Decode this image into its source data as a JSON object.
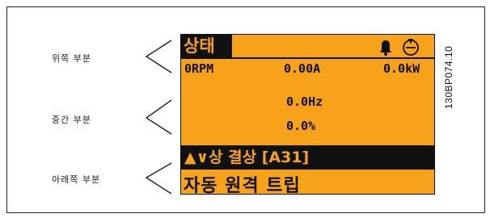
{
  "labels": {
    "top": "위쪽 부분",
    "middle": "중간 부분",
    "bottom": "아래쪽 부분"
  },
  "display": {
    "status_title": "상태",
    "readouts": {
      "speed": "0RPM",
      "current": "0.00A",
      "power": "0.0kW"
    },
    "frequency": "0.0Hz",
    "percent": "0.0%",
    "alarm_line": "▲∨상 결상 [A31]",
    "trip_line": "자동 원격 트립"
  },
  "doc_id": "130BP074.10",
  "colors": {
    "lcp_background": "#f7a21b",
    "lcp_ink": "#111111"
  },
  "icons": [
    "bell-icon",
    "motor-icon",
    "bracket-pointer"
  ]
}
